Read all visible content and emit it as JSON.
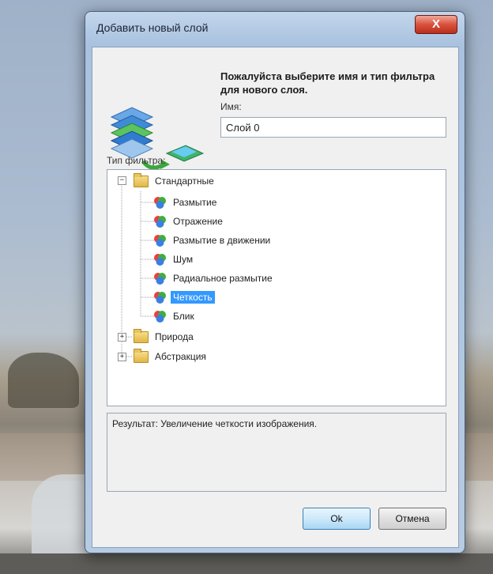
{
  "dialog": {
    "title": "Добавить новый слой",
    "close_label": "X",
    "prompt": "Пожалуйста выберите имя и тип фильтра для нового слоя.",
    "name_label": "Имя:",
    "name_value": "Слой 0",
    "filter_type_label": "Тип фильтра:",
    "tree": [
      {
        "label": "Стандартные",
        "type": "folder",
        "expanded": true,
        "children": [
          {
            "label": "Размытие"
          },
          {
            "label": "Отражение"
          },
          {
            "label": "Размытие в движении"
          },
          {
            "label": "Шум"
          },
          {
            "label": "Радиальное размытие"
          },
          {
            "label": "Четкость",
            "selected": true
          },
          {
            "label": "Блик"
          }
        ]
      },
      {
        "label": "Природа",
        "type": "folder",
        "expanded": false
      },
      {
        "label": "Абстракция",
        "type": "folder",
        "expanded": false
      }
    ],
    "result_text": "Результат: Увеличение четкости изображения.",
    "ok_label": "Ok",
    "cancel_label": "Отмена"
  },
  "icons": {
    "layers": "layers-icon",
    "filter": "filter-icon",
    "folder": "folder-icon"
  }
}
